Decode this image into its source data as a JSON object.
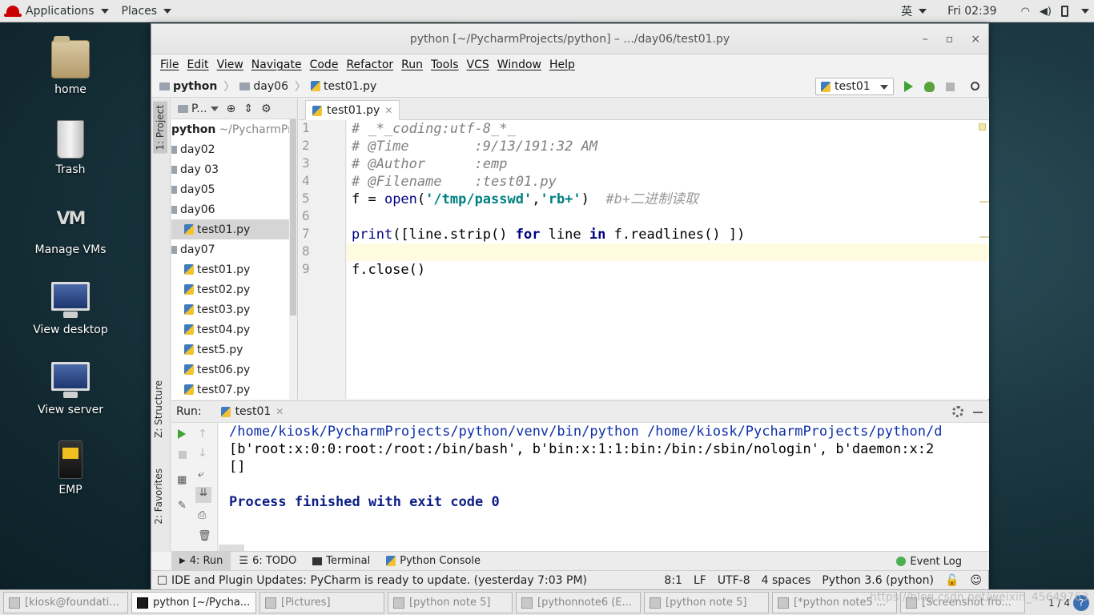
{
  "topbar": {
    "applications": "Applications",
    "places": "Places",
    "lang": "英",
    "clock": "Fri 02:39"
  },
  "desktop": {
    "icons": [
      "home",
      "Trash",
      "Manage VMs",
      "View desktop",
      "View server",
      "EMP"
    ]
  },
  "window": {
    "title": "python [~/PycharmProjects/python] – .../day06/test01.py",
    "controls": {
      "minimize": "–",
      "maximize": "▫",
      "close": "×"
    }
  },
  "menu": [
    "File",
    "Edit",
    "View",
    "Navigate",
    "Code",
    "Refactor",
    "Run",
    "Tools",
    "VCS",
    "Window",
    "Help"
  ],
  "breadcrumb": [
    "python",
    "day06",
    "test01.py"
  ],
  "run_config": "test01",
  "left_tabs": {
    "project": "1: Project",
    "structure": "Z: Structure",
    "favorites": "2: Favorites"
  },
  "project_panel": {
    "header": "P...",
    "root": "python",
    "root_path": "~/PycharmProjects/python",
    "items": [
      {
        "label": "day02",
        "type": "folder",
        "selected": false
      },
      {
        "label": "day 03",
        "type": "folder",
        "selected": false
      },
      {
        "label": "day05",
        "type": "folder",
        "selected": false
      },
      {
        "label": "day06",
        "type": "folder",
        "selected": false
      },
      {
        "label": "test01.py",
        "type": "file",
        "selected": true
      },
      {
        "label": "day07",
        "type": "folder",
        "selected": false
      },
      {
        "label": "test01.py",
        "type": "file",
        "selected": false
      },
      {
        "label": "test02.py",
        "type": "file",
        "selected": false
      },
      {
        "label": "test03.py",
        "type": "file",
        "selected": false
      },
      {
        "label": "test04.py",
        "type": "file",
        "selected": false
      },
      {
        "label": "test5.py",
        "type": "file",
        "selected": false
      },
      {
        "label": "test06.py",
        "type": "file",
        "selected": false
      },
      {
        "label": "test07.py",
        "type": "file",
        "selected": false
      }
    ]
  },
  "editor": {
    "tab": "test01.py",
    "line_numbers": [
      "1",
      "2",
      "3",
      "4",
      "5",
      "6",
      "7",
      "8",
      "9"
    ],
    "lines": {
      "l1": "# _*_coding:utf-8_*_",
      "l2": "# @Time        :9/13/191:32 AM",
      "l3": "# @Author      :emp",
      "l4": "# @Filename    :test01.py",
      "l5_a": "f = ",
      "l5_b": "open",
      "l5_c": "(",
      "l5_d": "'/tmp/passwd'",
      "l5_e": ",",
      "l5_f": "'rb+'",
      "l5_g": ")  ",
      "l5_h": "#b+二进制读取",
      "l7_a": "print",
      "l7_b": "([line.strip() ",
      "l7_c": "for",
      "l7_d": " line ",
      "l7_e": "in",
      "l7_f": " f.readlines() ])",
      "l9": "f.close()"
    }
  },
  "run_panel": {
    "label": "Run:",
    "tab": "test01",
    "output": [
      "/home/kiosk/PycharmProjects/python/venv/bin/python /home/kiosk/PycharmProjects/python/d",
      "[b'root:x:0:0:root:/root:/bin/bash', b'bin:x:1:1:bin:/bin:/sbin/nologin', b'daemon:x:2",
      "[]",
      "Process finished with exit code 0"
    ]
  },
  "tool_tabs": [
    "4: Run",
    "6: TODO",
    "Terminal",
    "Python Console"
  ],
  "event_log": "Event Log",
  "status": {
    "message": "IDE and Plugin Updates: PyCharm is ready to update. (yesterday 7:03 PM)",
    "position": "8:1",
    "line_sep": "LF",
    "encoding": "UTF-8",
    "indent": "4 spaces",
    "interpreter": "Python 3.6 (python)"
  },
  "taskbar": {
    "items": [
      {
        "label": "[kiosk@foundati...",
        "active": false
      },
      {
        "label": "python [~/Pycha...",
        "active": true
      },
      {
        "label": "[Pictures]",
        "active": false
      },
      {
        "label": "[python note 5]",
        "active": false
      },
      {
        "label": "[pythonnote6 (E...",
        "active": false
      },
      {
        "label": "[python note 5]",
        "active": false
      },
      {
        "label": "[*python note5 ...",
        "active": false
      },
      {
        "label": "[Screenshot fro...",
        "active": false
      }
    ],
    "pager": "1 / 4"
  },
  "watermark": "https://blog.csdn.net/weixin_45649763"
}
